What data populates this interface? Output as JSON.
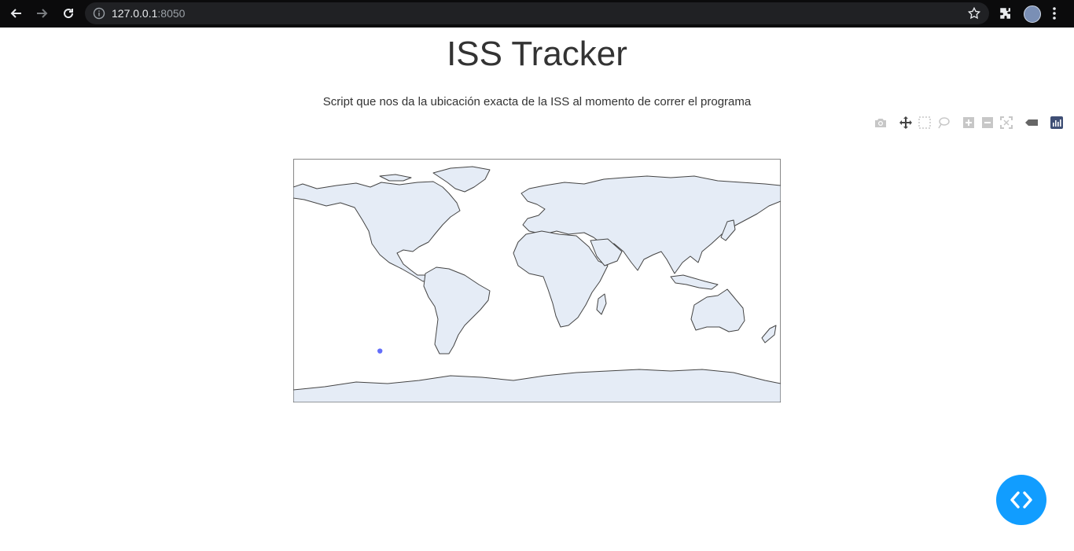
{
  "browser": {
    "url_host": "127.0.0.1",
    "url_port": ":8050"
  },
  "page": {
    "title": "ISS Tracker",
    "description": "Script que nos da la ubicación exacta de la ISS al momento de correr el programa"
  },
  "modebar": {
    "buttons": [
      "camera-icon",
      "pan-icon",
      "box-select-icon",
      "lasso-select-icon",
      "zoom-in-icon",
      "zoom-out-icon",
      "autoscale-icon",
      "hover-closest-icon",
      "plotly-logo-icon"
    ]
  },
  "chart_data": {
    "type": "scatter",
    "projection": "equirectangular world map",
    "land_color": "#e5ecf6",
    "coast_color": "#444444",
    "marker_color": "#636efa",
    "x": [
      -116
    ],
    "y": [
      -52
    ],
    "xlim": [
      -180,
      180
    ],
    "ylim": [
      -90,
      90
    ]
  },
  "colors": {
    "fab": "#119dff",
    "title_text": "#333333"
  }
}
